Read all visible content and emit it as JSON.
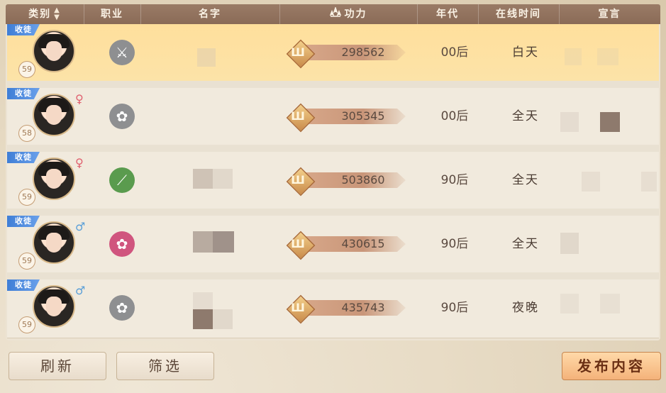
{
  "header": {
    "category": "类别",
    "job": "职业",
    "name": "名字",
    "power": "功力",
    "era": "年代",
    "online_time": "在线时间",
    "declaration": "宣言"
  },
  "rows": [
    {
      "tag": "收徒",
      "level": "59",
      "gender": "",
      "power": "298562",
      "era": "00后",
      "online": "白天",
      "selected": true,
      "job_icon": "sword-icon",
      "job_color": "#8e8f91"
    },
    {
      "tag": "收徒",
      "level": "58",
      "gender": "♀",
      "power": "305345",
      "era": "00后",
      "online": "全天",
      "selected": false,
      "job_icon": "lotus-icon",
      "job_color": "#8e8f91"
    },
    {
      "tag": "收徒",
      "level": "59",
      "gender": "♀",
      "power": "503860",
      "era": "90后",
      "online": "全天",
      "selected": false,
      "job_icon": "bamboo-icon",
      "job_color": "#5a9b4e"
    },
    {
      "tag": "收徒",
      "level": "59",
      "gender": "♂",
      "power": "430615",
      "era": "90后",
      "online": "全天",
      "selected": false,
      "job_icon": "lotus-icon",
      "job_color": "#d0557e"
    },
    {
      "tag": "收徒",
      "level": "59",
      "gender": "♂",
      "power": "435743",
      "era": "90后",
      "online": "夜晚",
      "selected": false,
      "job_icon": "lotus-icon",
      "job_color": "#8e8f91"
    }
  ],
  "buttons": {
    "refresh": "刷新",
    "filter": "筛选",
    "publish": "发布内容"
  }
}
